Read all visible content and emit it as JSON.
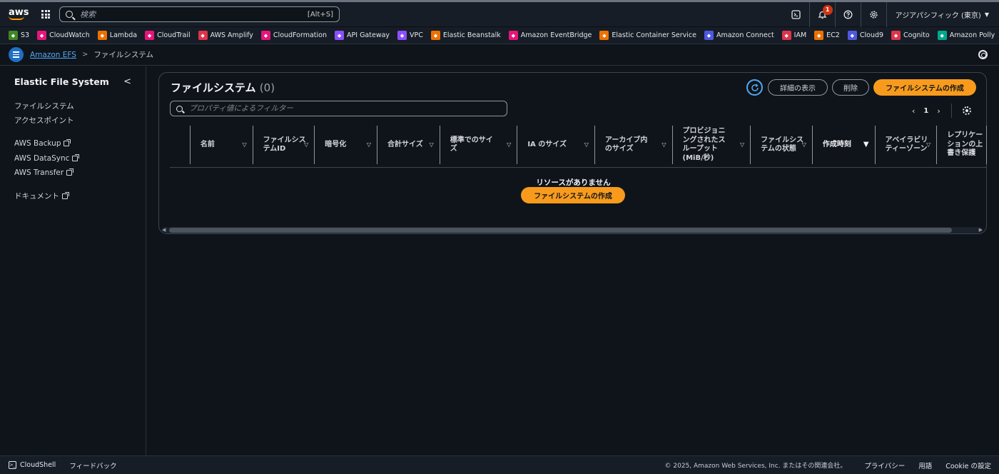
{
  "topnav": {
    "logo_text": "aws",
    "search_placeholder": "検索",
    "search_shortcut": "[Alt+S]",
    "notification_count": "1",
    "region": "アジアパシフィック (東京)"
  },
  "favorites": [
    {
      "label": "S3",
      "color": "#3f8624"
    },
    {
      "label": "CloudWatch",
      "color": "#e7157b"
    },
    {
      "label": "Lambda",
      "color": "#ed7100"
    },
    {
      "label": "CloudTrail",
      "color": "#e7157b"
    },
    {
      "label": "AWS Amplify",
      "color": "#dd344c"
    },
    {
      "label": "CloudFormation",
      "color": "#e7157b"
    },
    {
      "label": "API Gateway",
      "color": "#8c4fff"
    },
    {
      "label": "VPC",
      "color": "#8c4fff"
    },
    {
      "label": "Elastic Beanstalk",
      "color": "#ed7100"
    },
    {
      "label": "Amazon EventBridge",
      "color": "#e7157b"
    },
    {
      "label": "Elastic Container Service",
      "color": "#ed7100"
    },
    {
      "label": "Amazon Connect",
      "color": "#4d59e0"
    },
    {
      "label": "IAM",
      "color": "#dd344c"
    },
    {
      "label": "EC2",
      "color": "#ed7100"
    },
    {
      "label": "Cloud9",
      "color": "#4d59e0"
    },
    {
      "label": "Cognito",
      "color": "#dd344c"
    },
    {
      "label": "Amazon Polly",
      "color": "#01a88d"
    }
  ],
  "breadcrumb": {
    "service": "Amazon EFS",
    "current": "ファイルシステム"
  },
  "sidebar": {
    "title": "Elastic File System",
    "items": [
      "ファイルシステム",
      "アクセスポイント"
    ],
    "external_items": [
      "AWS Backup",
      "AWS DataSync",
      "AWS Transfer"
    ],
    "docs": "ドキュメント"
  },
  "panel": {
    "title": "ファイルシステム",
    "count": "(0)",
    "details_button": "詳細の表示",
    "delete_button": "削除",
    "create_button": "ファイルシステムの作成",
    "filter_placeholder": "プロパティ値によるフィルター",
    "page_number": "1",
    "columns": [
      {
        "label": "名前",
        "width": 88
      },
      {
        "label": "ファイルシステムID",
        "width": 87
      },
      {
        "label": "暗号化",
        "width": 88
      },
      {
        "label": "合計サイズ",
        "width": 88
      },
      {
        "label": "標準でのサイズ",
        "width": 109
      },
      {
        "label": "IA のサイズ",
        "width": 109
      },
      {
        "label": "アーカイブ内のサイズ",
        "width": 109
      },
      {
        "label": "プロビジョニングされたスループット (MiB/秒)",
        "width": 110
      },
      {
        "label": "ファイルシステムの状態",
        "width": 87
      },
      {
        "label": "作成時刻",
        "width": 88,
        "sorted": true
      },
      {
        "label": "アベイラビリティーゾーン",
        "width": 87
      },
      {
        "label": "レプリケーションの上書き保護",
        "width": 70
      }
    ],
    "empty_title": "リソースがありません",
    "empty_create_button": "ファイルシステムの作成"
  },
  "footer": {
    "cloudshell": "CloudShell",
    "feedback": "フィードバック",
    "copyright": "© 2025, Amazon Web Services, Inc. またはその関連会社。",
    "privacy": "プライバシー",
    "terms": "用語",
    "cookie": "Cookie の設定"
  }
}
